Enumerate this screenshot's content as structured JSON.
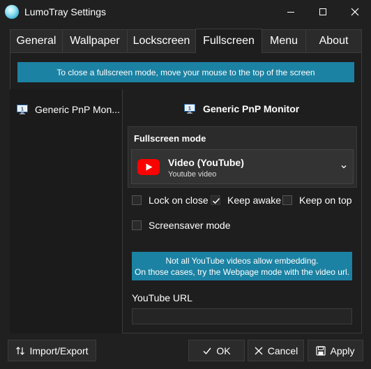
{
  "window": {
    "title": "LumoTray Settings"
  },
  "tabs": [
    "General",
    "Wallpaper",
    "Lockscreen",
    "Fullscreen",
    "Menu",
    "About"
  ],
  "active_tab": "Fullscreen",
  "banner_top": "To close a fullscreen mode, move your mouse to the top of the screen",
  "monitor_list": {
    "items": [
      "Generic PnP Mon..."
    ]
  },
  "detail": {
    "monitor_title": "Generic PnP Monitor",
    "mode_label": "Fullscreen mode",
    "mode_selected": {
      "name": "Video (YouTube)",
      "description": "Youtube video"
    }
  },
  "options": {
    "lock_on_close": {
      "label": "Lock on close",
      "checked": false
    },
    "keep_awake": {
      "label": "Keep awake",
      "checked": true
    },
    "keep_on_top": {
      "label": "Keep on top",
      "checked": false
    },
    "screensaver": {
      "label": "Screensaver mode",
      "checked": false
    }
  },
  "embed_notice": {
    "line1": "Not all YouTube videos allow embedding.",
    "line2": "On those cases, try the Webpage mode with the video url."
  },
  "youtube_url": {
    "label": "YouTube URL",
    "value": "",
    "placeholder": ""
  },
  "buttons": {
    "import_export": "Import/Export",
    "ok": "OK",
    "cancel": "Cancel",
    "apply": "Apply"
  },
  "colors": {
    "accent": "#1c82a3",
    "youtube_red": "#ff0000",
    "background": "#202020"
  }
}
